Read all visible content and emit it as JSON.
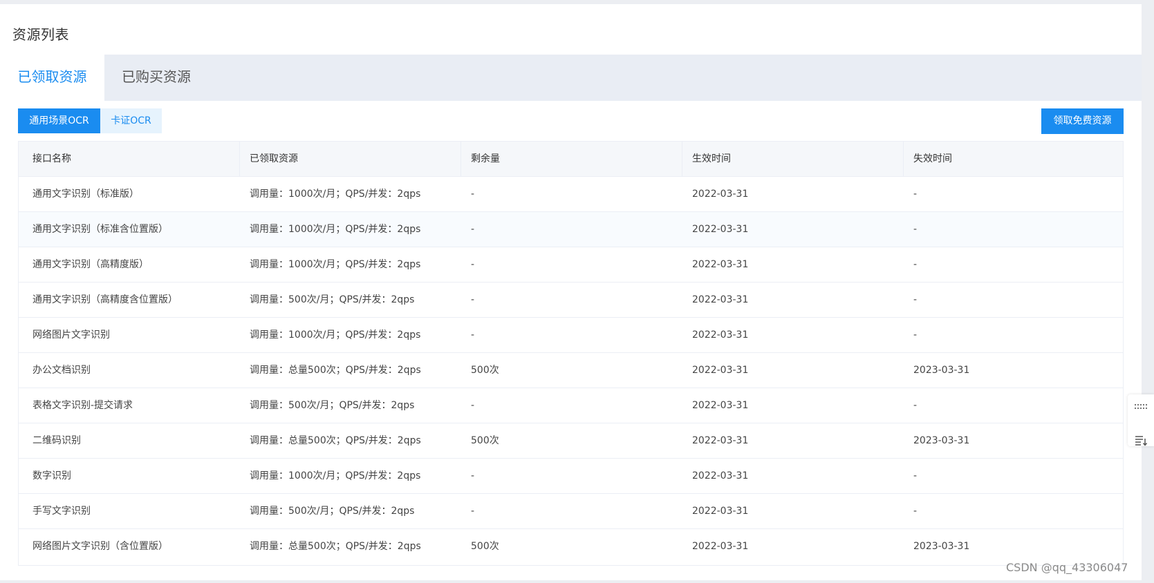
{
  "page": {
    "title": "资源列表"
  },
  "tabs": [
    {
      "label": "已领取资源"
    },
    {
      "label": "已购买资源"
    }
  ],
  "subtabs": [
    {
      "label": "通用场景OCR"
    },
    {
      "label": "卡证OCR"
    }
  ],
  "actions": {
    "claim_label": "领取免费资源"
  },
  "table": {
    "headers": [
      "接口名称",
      "已领取资源",
      "剩余量",
      "生效时间",
      "失效时间"
    ],
    "rows": [
      {
        "name": "通用文字识别（标准版）",
        "resource": "调用量：1000次/月；QPS/并发：2qps",
        "remaining": "-",
        "start": "2022-03-31",
        "end": "-"
      },
      {
        "name": "通用文字识别（标准含位置版）",
        "resource": "调用量：1000次/月；QPS/并发：2qps",
        "remaining": "-",
        "start": "2022-03-31",
        "end": "-"
      },
      {
        "name": "通用文字识别（高精度版）",
        "resource": "调用量：1000次/月；QPS/并发：2qps",
        "remaining": "-",
        "start": "2022-03-31",
        "end": "-"
      },
      {
        "name": "通用文字识别（高精度含位置版）",
        "resource": "调用量：500次/月；QPS/并发：2qps",
        "remaining": "-",
        "start": "2022-03-31",
        "end": "-"
      },
      {
        "name": "网络图片文字识别",
        "resource": "调用量：1000次/月；QPS/并发：2qps",
        "remaining": "-",
        "start": "2022-03-31",
        "end": "-"
      },
      {
        "name": "办公文档识别",
        "resource": "调用量：总量500次；QPS/并发：2qps",
        "remaining": "500次",
        "start": "2022-03-31",
        "end": "2023-03-31"
      },
      {
        "name": "表格文字识别-提交请求",
        "resource": "调用量：500次/月；QPS/并发：2qps",
        "remaining": "-",
        "start": "2022-03-31",
        "end": "-"
      },
      {
        "name": "二维码识别",
        "resource": "调用量：总量500次；QPS/并发：2qps",
        "remaining": "500次",
        "start": "2022-03-31",
        "end": "2023-03-31"
      },
      {
        "name": "数字识别",
        "resource": "调用量：1000次/月；QPS/并发：2qps",
        "remaining": "-",
        "start": "2022-03-31",
        "end": "-"
      },
      {
        "name": "手写文字识别",
        "resource": "调用量：500次/月；QPS/并发：2qps",
        "remaining": "-",
        "start": "2022-03-31",
        "end": "-"
      },
      {
        "name": "网络图片文字识别（含位置版）",
        "resource": "调用量：总量500次；QPS/并发：2qps",
        "remaining": "500次",
        "start": "2022-03-31",
        "end": "2023-03-31"
      }
    ]
  },
  "side_tools": [
    {
      "icon": "drag-handle-icon"
    },
    {
      "icon": "sort-list-icon"
    }
  ],
  "watermark": "CSDN @qq_43306047",
  "colors": {
    "accent": "#1a8cf0",
    "tab_bar": "#e9edf4",
    "header_bg": "#f5f7fa",
    "border": "#ebeef5"
  }
}
